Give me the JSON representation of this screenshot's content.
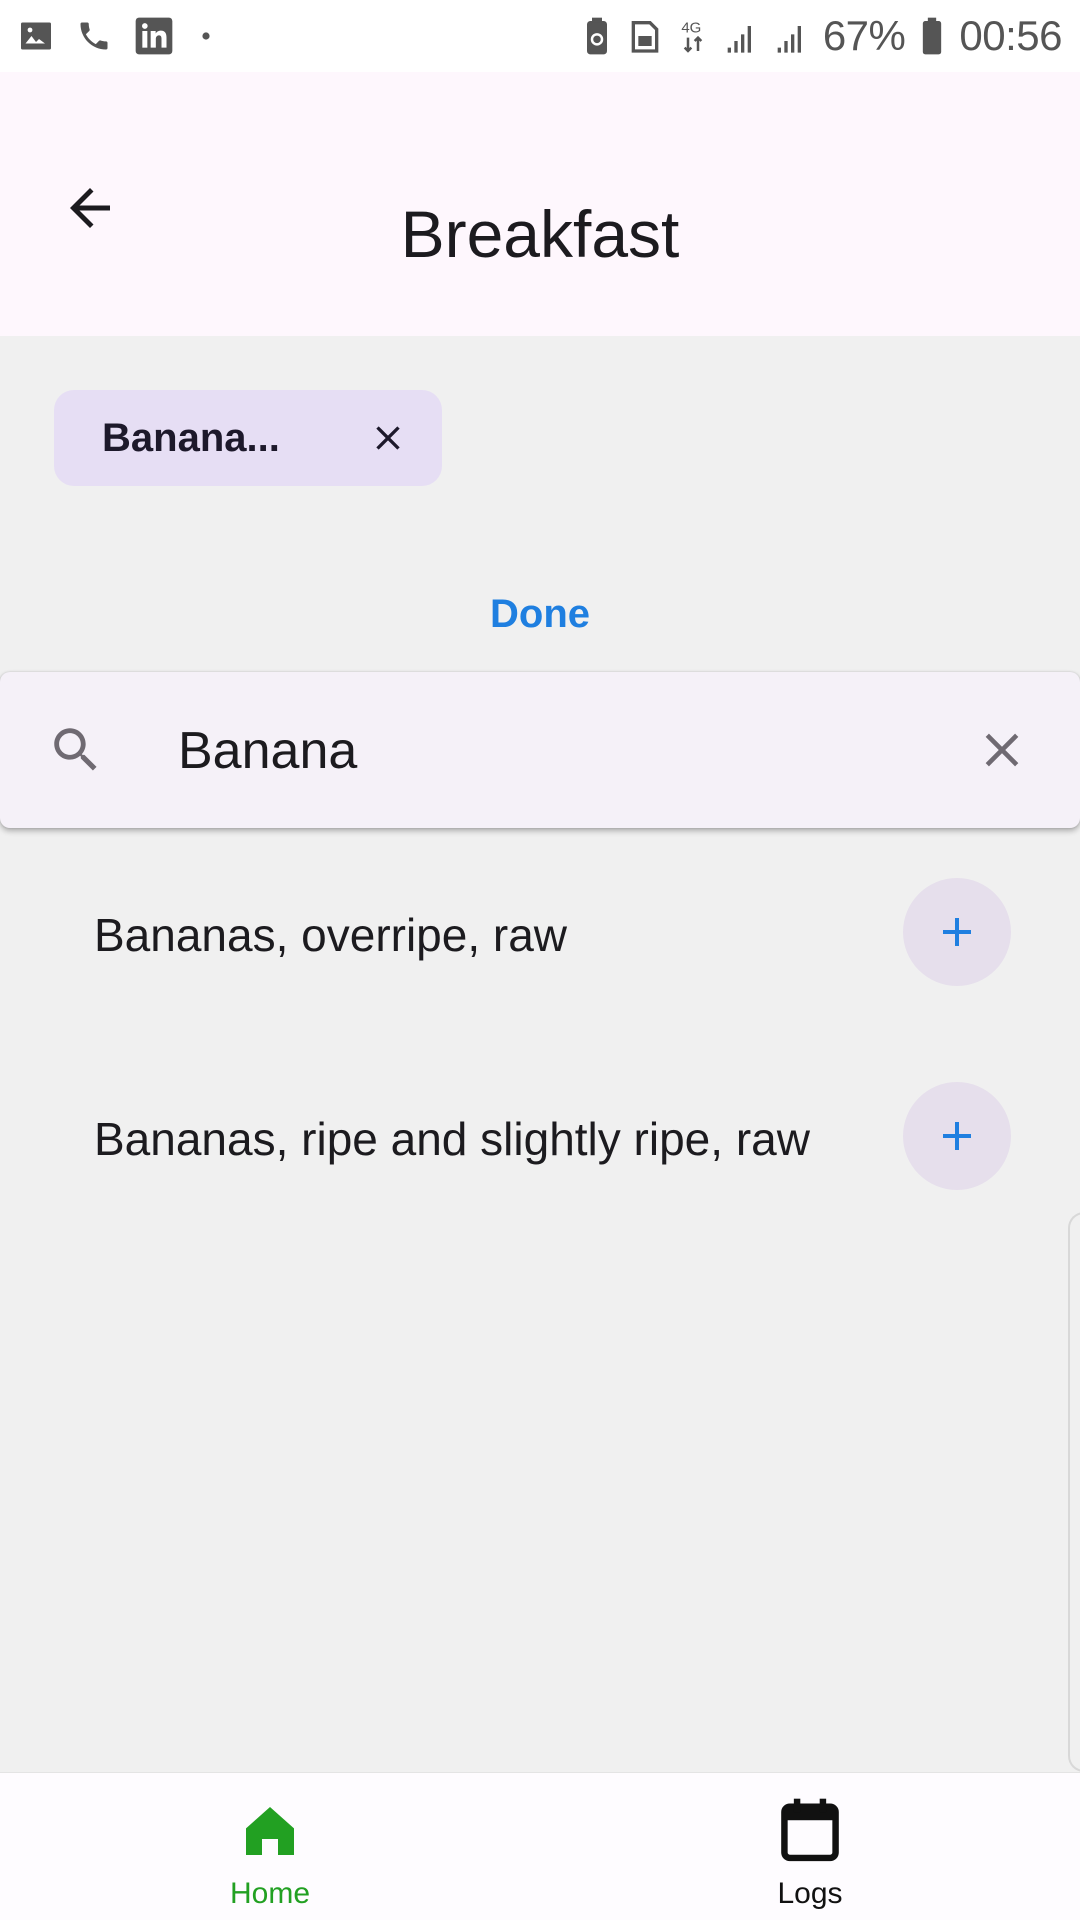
{
  "status_bar": {
    "battery_percent": "67%",
    "time": "00:56",
    "network": "4G",
    "icons": [
      "image-icon",
      "phone-icon",
      "linkedin-icon",
      "dot-icon",
      "battery-saver-icon",
      "sim-icon",
      "data-arrows-icon",
      "signal-icon",
      "signal-icon",
      "battery-icon"
    ]
  },
  "app_bar": {
    "title": "Breakfast",
    "back_icon": "arrow-back-icon"
  },
  "chip": {
    "label": "Banana...",
    "close_icon": "close-icon"
  },
  "done_label": "Done",
  "search": {
    "value": "Banana",
    "search_icon": "search-icon",
    "clear_icon": "close-icon"
  },
  "results": [
    {
      "label": "Bananas, overripe, raw"
    },
    {
      "label": "Bananas, ripe and slightly ripe, raw"
    }
  ],
  "bottom_nav": {
    "items": [
      {
        "label": "Home",
        "icon": "home-icon",
        "active": true
      },
      {
        "label": "Logs",
        "icon": "calendar-icon",
        "active": false
      }
    ]
  },
  "colors": {
    "accent_blue": "#1f7fe0",
    "active_green": "#22a022",
    "chip_bg": "#e6def4",
    "app_bar_bg": "#fef7fd",
    "page_bg": "#f0f0f0"
  }
}
